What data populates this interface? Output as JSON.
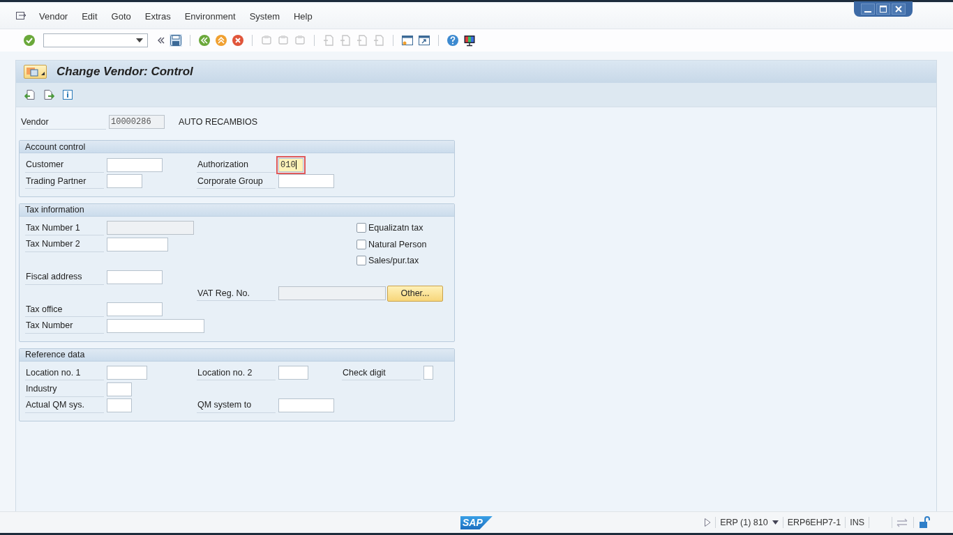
{
  "menu": [
    "Vendor",
    "Edit",
    "Goto",
    "Extras",
    "Environment",
    "System",
    "Help"
  ],
  "screen": {
    "title": "Change Vendor: Control"
  },
  "header_field": {
    "label": "Vendor",
    "value": "10000286",
    "description": "AUTO RECAMBIOS",
    "disabled": true
  },
  "groups": [
    {
      "title": "Account control",
      "items": [
        {
          "kind": "field",
          "label": "Customer",
          "disabled": false,
          "focused": false
        },
        {
          "kind": "field",
          "label": "Authorization",
          "value": "010",
          "disabled": false,
          "focused": true
        },
        {
          "kind": "field",
          "label": "Trading Partner",
          "disabled": false,
          "focused": false
        },
        {
          "kind": "field",
          "label": "Corporate Group",
          "disabled": false,
          "focused": false
        }
      ]
    },
    {
      "title": "Tax information",
      "items": [
        {
          "kind": "field",
          "label": "Tax Number 1",
          "disabled": true,
          "focused": false
        },
        {
          "kind": "checkbox",
          "label": "Equalizatn tax",
          "checked": false
        },
        {
          "kind": "field",
          "label": "Tax Number 2",
          "disabled": false,
          "focused": false
        },
        {
          "kind": "checkbox",
          "label": "Natural Person",
          "checked": false
        },
        {
          "kind": "checkbox",
          "label": "Sales/pur.tax",
          "checked": false
        },
        {
          "kind": "field",
          "label": "Fiscal address",
          "disabled": false,
          "focused": false
        },
        {
          "kind": "field",
          "label": "VAT Reg. No.",
          "disabled": true,
          "focused": false
        },
        {
          "kind": "button",
          "label": "Other..."
        },
        {
          "kind": "field",
          "label": "Tax office",
          "disabled": false,
          "focused": false
        },
        {
          "kind": "field",
          "label": "Tax Number",
          "disabled": false,
          "focused": false
        }
      ]
    },
    {
      "title": "Reference data",
      "items": [
        {
          "kind": "field",
          "label": "Location no. 1",
          "disabled": false,
          "focused": false
        },
        {
          "kind": "field",
          "label": "Location no. 2",
          "disabled": false,
          "focused": false
        },
        {
          "kind": "field",
          "label": "Check digit",
          "disabled": false,
          "focused": false
        },
        {
          "kind": "field",
          "label": "Industry",
          "disabled": false,
          "focused": false
        },
        {
          "kind": "field",
          "label": "Actual QM sys.",
          "disabled": false,
          "focused": false
        },
        {
          "kind": "field",
          "label": "QM system to",
          "disabled": false,
          "focused": false
        }
      ]
    }
  ],
  "status_bar": {
    "logo": "SAP",
    "system": "ERP (1) 810",
    "server": "ERP6EHP7-1",
    "mode": "INS"
  }
}
